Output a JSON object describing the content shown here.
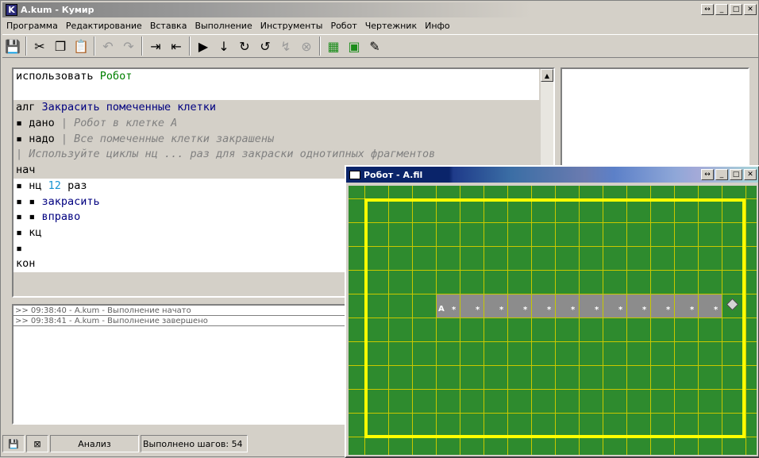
{
  "window": {
    "title": "A.kum - Кумир",
    "icon_letter": "K"
  },
  "menu": [
    "Программа",
    "Редактирование",
    "Вставка",
    "Выполнение",
    "Инструменты",
    "Робот",
    "Чертежник",
    "Инфо"
  ],
  "editor": {
    "lines": [
      {
        "k": "использовать",
        "r": "Робот",
        "rc": "grn",
        "bg": "white"
      },
      {
        "k": "",
        "bg": "white"
      },
      {
        "k": "алг",
        "r": "Закрасить помеченные клетки",
        "rc": "blu",
        "bg": "gray"
      },
      {
        "k": "▪ дано",
        "r": "| Робот в клетке А",
        "rc": "com",
        "bg": "gray"
      },
      {
        "k": "▪ надо",
        "r": "| Все помеченные клетки закрашены",
        "rc": "com",
        "bg": "gray"
      },
      {
        "k": "",
        "r": "| Используйте циклы нц ... раз для закраски однотипных фрагментов",
        "rc": "com",
        "bg": "gray"
      },
      {
        "k": "нач",
        "bg": "gray"
      },
      {
        "k": "▪ нц",
        "n": "12",
        "t": "раз",
        "bg": "white"
      },
      {
        "k": "▪ ▪",
        "r": "закрасить",
        "rc": "blu",
        "bg": "white"
      },
      {
        "k": "▪ ▪",
        "r": "вправо",
        "rc": "blu",
        "bg": "white"
      },
      {
        "k": "▪ кц",
        "bg": "white"
      },
      {
        "k": "▪",
        "bg": "white"
      },
      {
        "k": "кон",
        "bg": "white"
      }
    ]
  },
  "log": [
    ">> 09:38:40 - A.kum - Выполнение начато",
    ">> 09:38:41 - A.kum - Выполнение завершено"
  ],
  "status": {
    "analysis": "Анализ",
    "steps": "Выполнено шагов: 54"
  },
  "robot_window": {
    "title": "Робот - A.fil",
    "field": {
      "cols": 17,
      "rows": 11,
      "painted_row": 4,
      "painted_from_col": 3,
      "painted_to_col": 14,
      "robot_col": 15,
      "robot_row": 4,
      "start_label": "А",
      "mark": "*"
    }
  },
  "colors": {
    "field": "#2e8b2e",
    "wall": "#ffff00",
    "painted": "#8c8c8c",
    "grid": "#c8c800"
  }
}
